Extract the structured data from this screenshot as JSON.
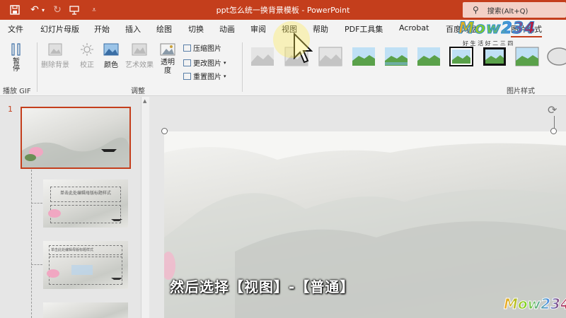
{
  "window": {
    "title": "ppt怎么统一换背景模板  -  PowerPoint",
    "search_label": "搜索(Alt+Q)"
  },
  "tabs": [
    "文件",
    "幻灯片母版",
    "开始",
    "插入",
    "绘图",
    "切换",
    "动画",
    "审阅",
    "视图",
    "帮助",
    "PDF工具集",
    "Acrobat",
    "百度网盘",
    "图片格式"
  ],
  "ribbon": {
    "pause_label": "暂停",
    "play_gif_group": "播放 GIF",
    "remove_bg": "删除背景",
    "correct": "校正",
    "color": "颜色",
    "art_effect": "艺术效果",
    "transparency": "透明度",
    "compress": "压缩图片",
    "change": "更改图片",
    "reset": "重置图片",
    "adjust_group": "调整",
    "styles_group": "图片样式"
  },
  "thumbs": {
    "slide_number": "1",
    "title_text": "单击此处编辑母版标题样式",
    "body_text": "单击此处编辑母版标题样式"
  },
  "overlay": {
    "subtitle": "然后选择【视图】-【普通】",
    "watermark": "Mow234",
    "watermark_sub": "好 生 活 好 二 三 四",
    "watermark_bottom": "Mow234"
  },
  "colors": {
    "accent": "#c43e1c",
    "ribbon_bg": "#f3f3f3",
    "selection": "#c43e1c"
  }
}
